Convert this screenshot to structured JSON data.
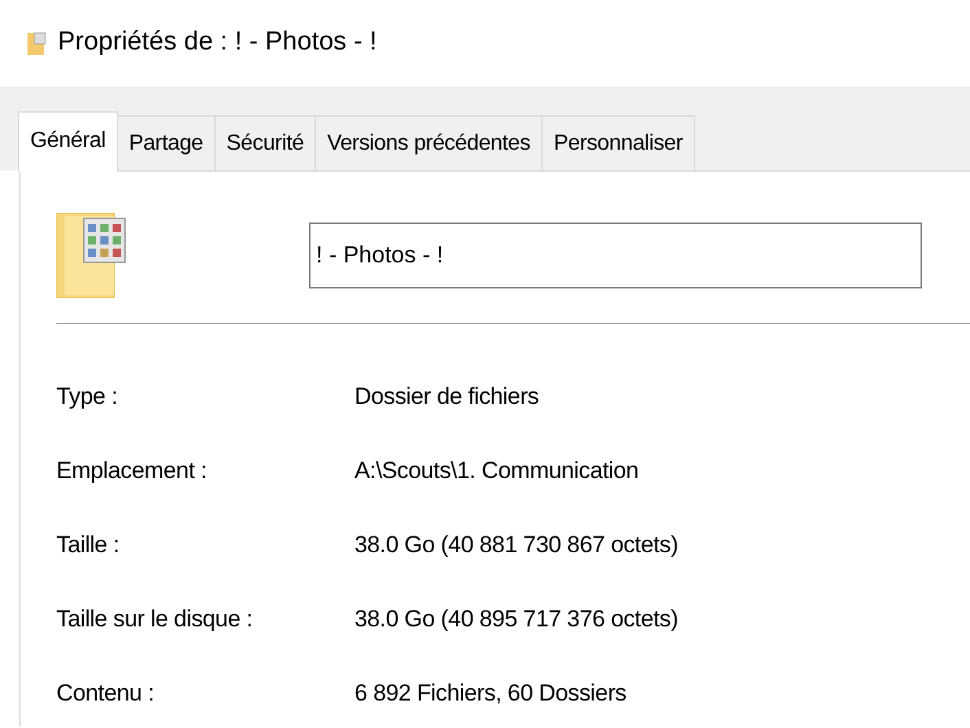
{
  "window": {
    "title": "Propriétés de : ! - Photos - !"
  },
  "tabs": [
    {
      "label": "Général",
      "selected": true
    },
    {
      "label": "Partage",
      "selected": false
    },
    {
      "label": "Sécurité",
      "selected": false
    },
    {
      "label": "Versions précédentes",
      "selected": false
    },
    {
      "label": "Personnaliser",
      "selected": false
    }
  ],
  "name_field": {
    "value": "! - Photos - !"
  },
  "properties": [
    {
      "label": "Type :",
      "value": "Dossier de fichiers"
    },
    {
      "label": "Emplacement :",
      "value": "A:\\Scouts\\1. Communication"
    },
    {
      "label": "Taille :",
      "value": "38.0 Go (40 881 730 867 octets)"
    },
    {
      "label": "Taille sur le disque :",
      "value": "38.0 Go (40 895 717 376 octets)"
    },
    {
      "label": "Contenu :",
      "value": "6 892 Fichiers, 60 Dossiers"
    }
  ]
}
